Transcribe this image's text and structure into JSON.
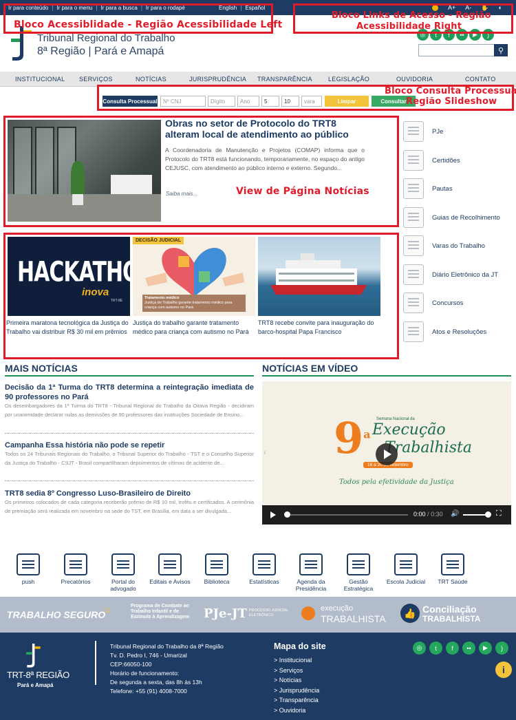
{
  "top_bar": {
    "skip_links": [
      "Ir para conteúdo",
      "Ir para o menu",
      "Ir para a busca",
      "Ir para o rodapé"
    ],
    "languages": [
      "English",
      "Español"
    ],
    "font_controls": [
      "A+",
      "A-"
    ]
  },
  "annotations": {
    "acessibilidade_left": "Bloco Acessiblidade - Região Acessibilidade Left",
    "links_right_line1": "Bloco Links de Acesso - Região",
    "links_right_line2": "Acessibilidade Right",
    "consulta_line1": "Bloco Consulta Processual",
    "consulta_line2": "Região Slideshow",
    "view_noticias": "View de Página Notícias"
  },
  "header": {
    "title_line1": "Tribunal Regional do Trabalho",
    "title_line2": "8ª Região | Pará e Amapá",
    "social_icons": [
      "instagram-icon",
      "twitter-icon",
      "facebook-icon",
      "flickr-icon",
      "youtube-icon",
      "rss-icon"
    ],
    "search_placeholder": "",
    "search_icon": "search-icon"
  },
  "nav": {
    "items": [
      "INSTITUCIONAL",
      "SERVIÇOS",
      "NOTÍCIAS",
      "JURISPRUDÊNCIA",
      "TRANSPARÊNCIA",
      "LEGISLAÇÃO",
      "OUVIDORIA",
      "CONTATO"
    ]
  },
  "consulta_processual": {
    "label": "Consulta Processual",
    "cnj_placeholder": "Nº CNJ",
    "digito_placeholder": "Dígito",
    "ano_placeholder": "Ano",
    "justica_value": "5",
    "tribunal_value": "10",
    "vara_placeholder": "vara",
    "limpar_label": "Limpar",
    "consultar_label": "Consultar"
  },
  "featured_news": {
    "title": "Obras no setor de Protocolo do TRT8 alteram local de atendimento ao público",
    "summary": "A Coordenadoria de Manutenção e Projetos (COMAP) informa que o Protocolo do TRT8 está funcionando, temporariamente, no espaço do antigo CEJUSC, com atendimento ao público interno e externo. Segundo...",
    "more_label": "Saiba mais..."
  },
  "news_cards": [
    {
      "caption": "Primeira maratona tecnológica da Justiça do Trabalho vai distribuir R$ 30 mil em prêmios",
      "image_title": "HACKATHON",
      "image_brand": "inova",
      "image_brand_sub": "TRT-8E"
    },
    {
      "caption": "Justiça do trabalho garante tratamento médico para criança com autismo no Pará",
      "image_tag": "DECISÃO JUDICIAL",
      "image_caption_title": "Tratamento médico",
      "image_caption_text": "Justiça do Trabalho garante tratamento médico para criança com autismo no Pará"
    },
    {
      "caption": "TRT8 recebe convite para inauguração do barco-hospital Papa Francisco"
    }
  ],
  "services": [
    {
      "label": "PJe",
      "icon": "circuit-board-icon"
    },
    {
      "label": "Certidões",
      "icon": "certificate-icon"
    },
    {
      "label": "Pautas",
      "icon": "checklist-icon"
    },
    {
      "label": "Guias de Recolhimento",
      "icon": "barcode-icon"
    },
    {
      "label": "Varas do Trabalho",
      "icon": "scales-icon"
    },
    {
      "label": "Diário Eletrônico da JT",
      "icon": "web-page-icon"
    },
    {
      "label": "Concursos",
      "icon": "edit-icon"
    },
    {
      "label": "Atos e Resoluções",
      "icon": "document-icon"
    }
  ],
  "mais_noticias": {
    "heading": "MAIS NOTÍCIAS",
    "items": [
      {
        "title": "Decisão da 1ª Turma do TRT8 determina a reintegração imediata de 90 professores no Pará",
        "text": "Os desembargadores da 1ª Turma do TRT8 - Tribunal Regional do Trabalho da Oitava Região - decidiram por unanimidade declarar nulas as demissões de 90 professores das instituições Sociedade de Ensino..."
      },
      {
        "title": "Campanha Essa história não pode se repetir",
        "text": "Todos os 24 Tribunais Regionais do Trabalho, o Tribunal Superior do Trabalho - TST e o Conselho Superior da Justiça do Trabalho - CSJT - Brasil compartilharam depoimentos de vítimas de acidente de..."
      },
      {
        "title": "TRT8 sedia 8º Congresso Luso-Brasileiro de Direito",
        "text": "Os primeiros colocados de cada categoria receberão prêmio de R$ 10 mil, troféu e certificados. A cerimônia de premiação será realizada em novembro na sede do TST, em Brasília, em data a ser divulgada..."
      }
    ]
  },
  "noticias_video": {
    "heading": "NOTÍCIAS EM VÍDEO",
    "poster_number": "9",
    "poster_superscript": "a",
    "poster_week": "Semana Nacional da",
    "poster_title_1": "Execução",
    "poster_title_2": "Trabalhista",
    "poster_dates": "16 a 20 de setembro",
    "poster_slogan": "Todos pela efetividade da Justiça",
    "current_time": "0:00",
    "duration": "0:30",
    "progress": 0,
    "volume": 1
  },
  "quick_links": [
    "push",
    "Precatórios",
    "Portal do advogado",
    "Editais e Avisos",
    "Biblioteca",
    "Estatísticas",
    "Agenda da Presidência",
    "Gestão Estratégica",
    "Escola Judicial",
    "TRT Saúde"
  ],
  "programs_band": {
    "trabalho_seguro": "TRABALHO SEGURO",
    "programa_infantil": "Programa de Combate ao Trabalho Infantil e de Estímulo à Aprendizagem",
    "pje_jt": "PJe-JT",
    "pje_sub": "PROCESSO JUDICIAL ELETRÔNICO",
    "execucao_1": "execução",
    "execucao_2": "TRABALHISTA",
    "conciliacao_1": "Conciliação",
    "conciliacao_2": "TRABALHISTA"
  },
  "footer": {
    "logo_name": "TRT-8ª REGIÃO",
    "logo_sub": "Pará e Amapá",
    "address_lines": [
      "Tribunal Regional do Trabalho da 8ª Região",
      "Tv. D. Pedro I, 746 - Umarizal",
      "CEP:66050-100",
      "Horário de funcionamento:",
      "De segunda a sexta, das 8h às 13h",
      "Telefone: +55 (91) 4008-7000"
    ],
    "map_heading": "Mapa do site",
    "map_links": [
      "> Institucional",
      "> Serviços",
      "> Notícias",
      "> Jurisprudência",
      "> Transparência",
      "> Ouvidoria"
    ],
    "info_icon": "info-icon"
  }
}
